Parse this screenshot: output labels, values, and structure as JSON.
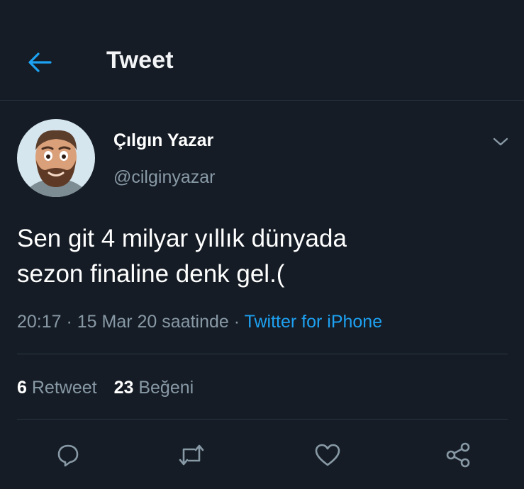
{
  "header": {
    "title": "Tweet",
    "back_icon": "arrow-left-icon"
  },
  "tweet": {
    "author": {
      "display_name": "Çılgın Yazar",
      "handle": "@cilginyazar"
    },
    "text_lines": [
      "Sen git 4 milyar yıllık dünyada",
      "sezon finaline denk gel.("
    ],
    "timestamp": "20:17 · 15 Mar 20 saatinde",
    "separator": " · ",
    "source": "Twitter for iPhone",
    "stats": {
      "retweets_count": "6",
      "retweets_label": "Retweet",
      "likes_count": "23",
      "likes_label": "Beğeni"
    }
  },
  "actions": [
    "reply-icon",
    "retweet-icon",
    "like-icon",
    "share-icon"
  ],
  "colors": {
    "background": "#151c25",
    "accent": "#1da1f2",
    "secondary_text": "#8899a6",
    "divider": "#2b3540"
  }
}
